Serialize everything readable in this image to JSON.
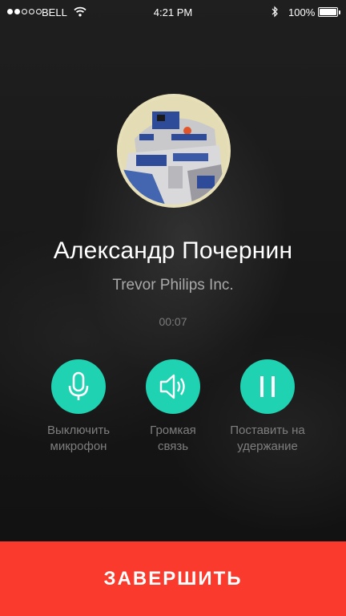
{
  "status_bar": {
    "carrier": "BELL",
    "time": "4:21 PM",
    "battery": "100%",
    "battery_level": 1.0,
    "signal_bars_filled": 2,
    "signal_bars_total": 5
  },
  "caller": {
    "name": "Александр Почернин",
    "company": "Trevor Philips Inc.",
    "duration": "00:07"
  },
  "actions": [
    {
      "line1": "Выключить",
      "line2": "микрофон",
      "icon": "microphone-icon"
    },
    {
      "line1": "Громкая",
      "line2": "связь",
      "icon": "speaker-icon"
    },
    {
      "line1": "Поставить на",
      "line2": "удержание",
      "icon": "pause-icon"
    }
  ],
  "end_call": {
    "label": "ЗАВЕРШИТЬ"
  },
  "colors": {
    "accent": "#1fd2b2",
    "end": "#f93a2c"
  }
}
